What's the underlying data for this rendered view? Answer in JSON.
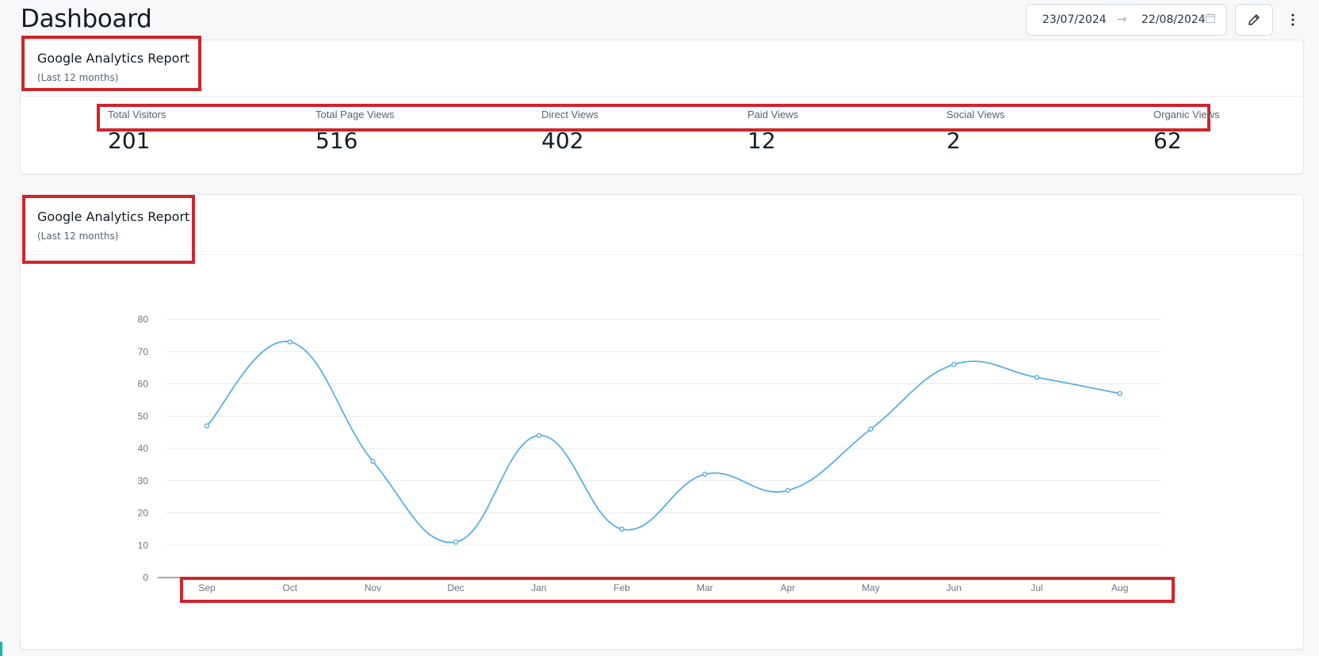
{
  "page": {
    "title": "Dashboard"
  },
  "toolbar": {
    "date_start": "23/07/2024",
    "date_arrow": "→",
    "date_end": "22/08/2024",
    "calendar_icon": "calendar-icon",
    "edit_icon": "pencil-icon",
    "more_icon": "vertical-dots-icon"
  },
  "summary_card": {
    "title": "Google Analytics Report",
    "subtitle": "(Last 12 months)",
    "stats": [
      {
        "label": "Total Visitors",
        "value": "201"
      },
      {
        "label": "Total Page Views",
        "value": "516"
      },
      {
        "label": "Direct Views",
        "value": "402"
      },
      {
        "label": "Paid Views",
        "value": "12"
      },
      {
        "label": "Social Views",
        "value": "2"
      },
      {
        "label": "Organic Views",
        "value": "62"
      }
    ]
  },
  "chart_card": {
    "title": "Google Analytics Report",
    "subtitle": "(Last 12 months)"
  },
  "colors": {
    "highlight": "#d0242b",
    "line": "#5aaee4",
    "grid": "#e6e9ec"
  },
  "chart_data": {
    "type": "line",
    "categories": [
      "Sep",
      "Oct",
      "Nov",
      "Dec",
      "Jan",
      "Feb",
      "Mar",
      "Apr",
      "May",
      "Jun",
      "Jul",
      "Aug"
    ],
    "series": [
      {
        "values": [
          47,
          73,
          36,
          11,
          44,
          15,
          32,
          27,
          46,
          66,
          62,
          57
        ]
      }
    ],
    "ylim": [
      0,
      80
    ],
    "yticks": [
      0,
      10,
      20,
      30,
      40,
      50,
      60,
      70,
      80
    ],
    "grid": true,
    "smooth": true,
    "title": "",
    "xlabel": "",
    "ylabel": ""
  }
}
